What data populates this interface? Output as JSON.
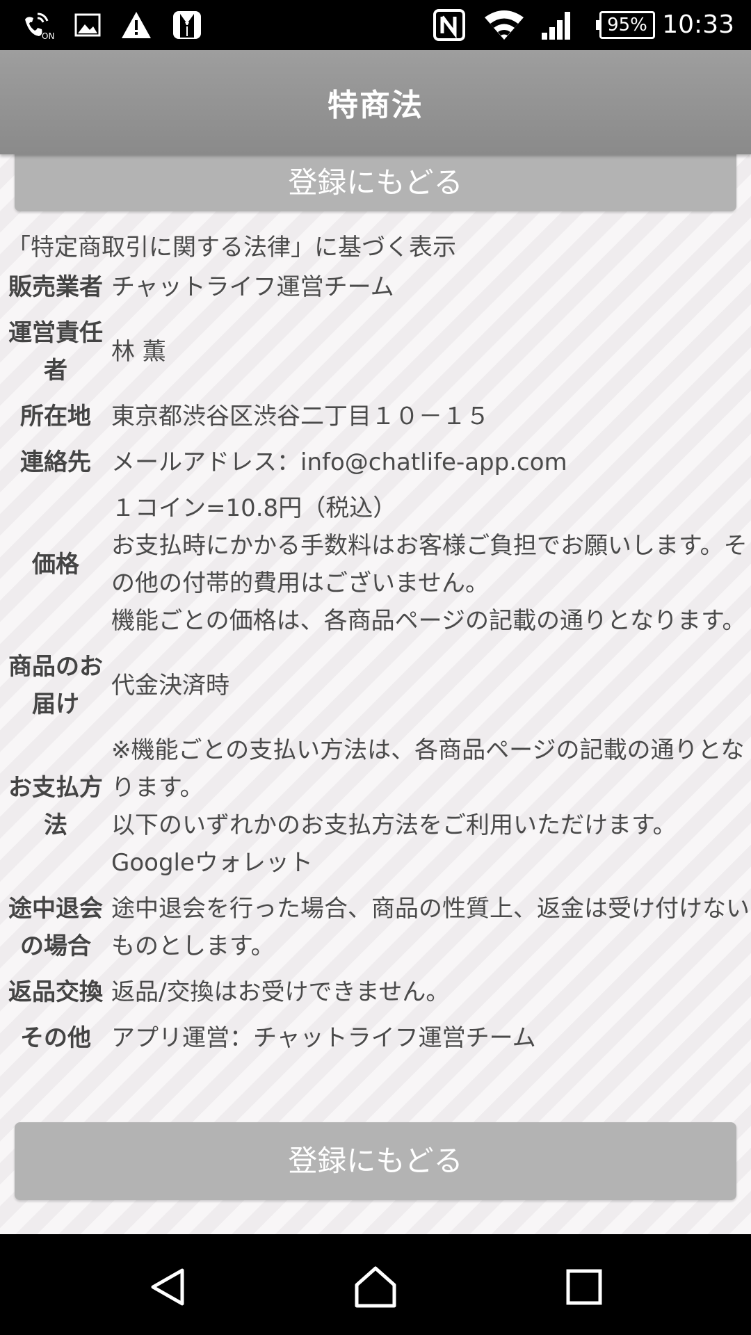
{
  "status_bar": {
    "time": "10:33",
    "battery": "95%",
    "icons": [
      "wifi-calling-icon",
      "gallery-icon",
      "warning-icon",
      "tuxedo-icon",
      "nfc-icon",
      "wifi-icon",
      "signal-icon",
      "battery-icon"
    ]
  },
  "header": {
    "title": "特商法"
  },
  "buttons": {
    "back_label": "登録にもどる"
  },
  "law": {
    "heading": "「特定商取引に関する法律」に基づく表示",
    "rows": [
      {
        "label": "販売業者",
        "lines": [
          "チャットライフ運営チーム"
        ]
      },
      {
        "label": "運営責任者",
        "lines": [
          "林 薫"
        ]
      },
      {
        "label": "所在地",
        "lines": [
          "東京都渋谷区渋谷二丁目１０－１５"
        ]
      },
      {
        "label": "連絡先",
        "lines": [
          "メールアドレス：info@chatlife-app.com"
        ]
      },
      {
        "label": "価格",
        "lines": [
          "１コイン=10.8円（税込）",
          "お支払時にかかる手数料はお客様ご負担でお願いします。その他の付帯的費用はございません。",
          "機能ごとの価格は、各商品ページの記載の通りとなります。"
        ]
      },
      {
        "label": "商品のお届け",
        "lines": [
          "代金決済時"
        ]
      },
      {
        "label": "お支払方法",
        "lines": [
          "※機能ごとの支払い方法は、各商品ページの記載の通りとなります。",
          "以下のいずれかのお支払方法をご利用いただけます。",
          "Googleウォレット"
        ]
      },
      {
        "label": "途中退会の場合",
        "lines": [
          "途中退会を行った場合、商品の性質上、返金は受け付けないものとします。"
        ]
      },
      {
        "label": "返品交換",
        "lines": [
          "返品/交換はお受けできません。"
        ]
      },
      {
        "label": "その他",
        "lines": [
          "アプリ運営：チャットライフ運営チーム"
        ]
      }
    ]
  },
  "colors": {
    "header_bg": "#999999",
    "button_bg": "#b3b3b3",
    "text": "#4a4a4a"
  }
}
